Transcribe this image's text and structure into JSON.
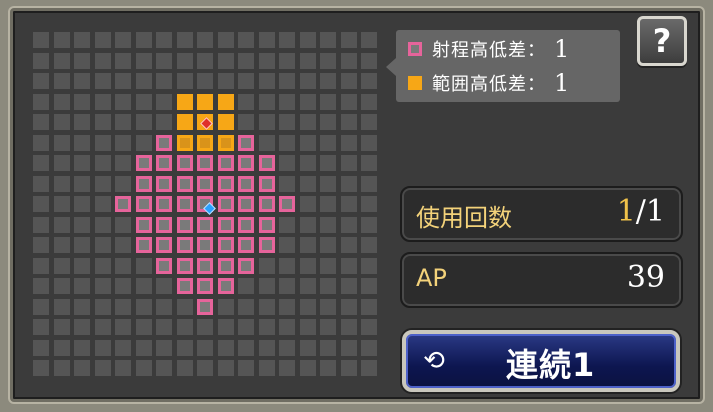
{
  "legend": {
    "range_height_label": "射程高低差：",
    "range_height_value": "1",
    "range_color": "#e6649b",
    "aoe_height_label": "範囲高低差：",
    "aoe_height_value": "1",
    "aoe_color": "#f7a716"
  },
  "help": {
    "label": "?",
    "icon": "question-mark-icon"
  },
  "uses": {
    "label": "使用回数",
    "current": "1",
    "sep": "/",
    "max": "1"
  },
  "ap": {
    "label": "AP",
    "value": "39"
  },
  "chain_button": {
    "label": "連続1",
    "icon": "cycle-arrows-icon",
    "glyph": "⟲"
  },
  "colors": {
    "background": "#3b3b3b",
    "grid_cell": "#555555",
    "range": "#e6649b",
    "aoe": "#f7a716",
    "caster_marker": "#2aa0ff",
    "target_marker": "#e0302a"
  }
}
